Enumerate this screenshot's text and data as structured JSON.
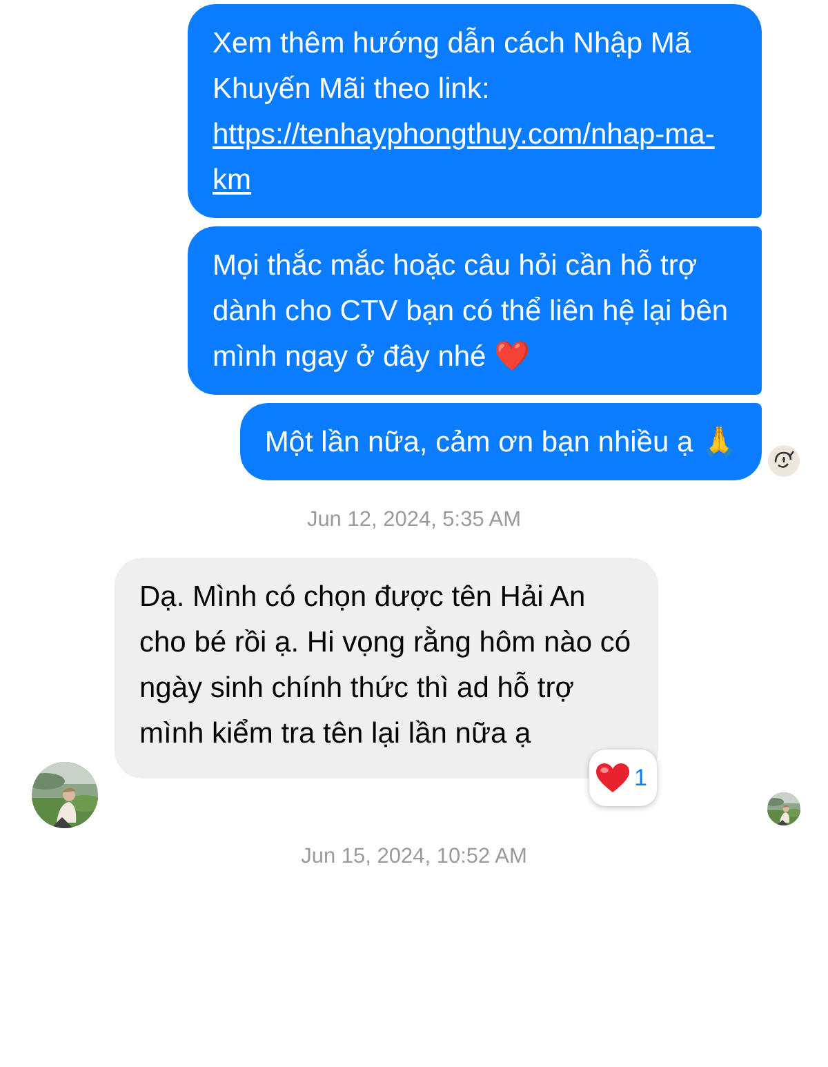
{
  "thread": [
    {
      "kind": "outgoing",
      "text": "Xem thêm hướng dẫn cách Nhập Mã Khuyến Mãi theo link:",
      "link": "https://tenhayphongthuy.com/nhap-ma-km",
      "seen": false
    },
    {
      "kind": "outgoing",
      "text": "Mọi thắc mắc hoặc câu hỏi cần hỗ trợ dành cho CTV bạn có thể liên hệ lại bên mình ngay ở đây nhé ❤️",
      "seen": false
    },
    {
      "kind": "outgoing",
      "text": "Một lần nữa, cảm ơn bạn nhiều ạ 🙏",
      "seen": true
    },
    {
      "kind": "timestamp",
      "text": "Jun 12, 2024, 5:35 AM"
    },
    {
      "kind": "incoming",
      "text": "Dạ. Mình có chọn được tên Hải An cho bé rồi ạ. Hi vọng rằng hôm nào có ngày sinh chính thức thì ad hỗ trợ mình kiểm tra tên lại lần nữa ạ",
      "reaction_count": "1",
      "seen": true
    },
    {
      "kind": "timestamp",
      "text": "Jun 15, 2024, 10:52 AM"
    }
  ]
}
